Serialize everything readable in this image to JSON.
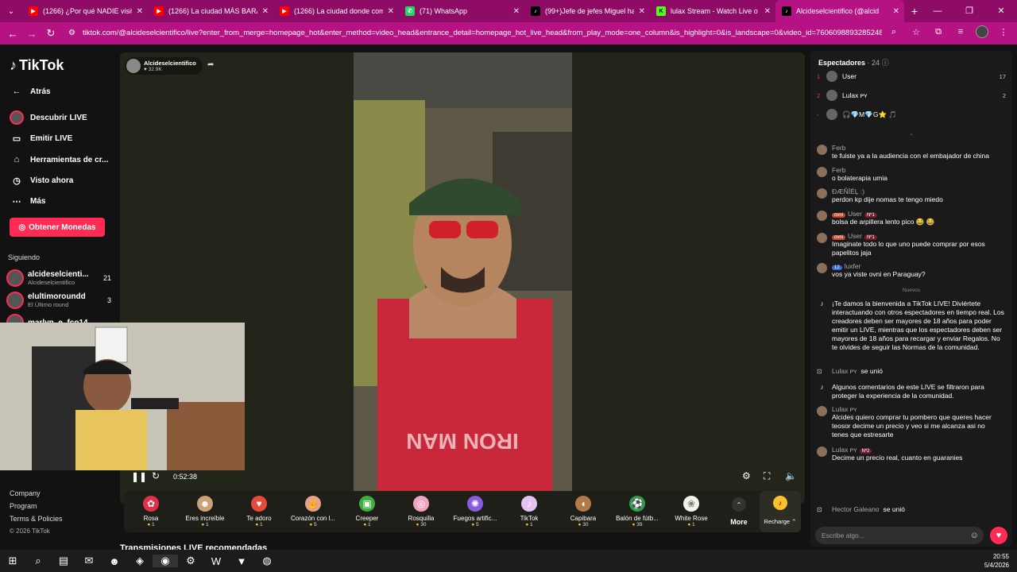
{
  "browser": {
    "tabs": [
      {
        "title": "(1266) ¿Por qué NADIE visita Pa",
        "icon": "youtube-icon",
        "color": "#ff0000"
      },
      {
        "title": "(1266) La ciudad MÁS BARATA",
        "icon": "youtube-icon",
        "color": "#ff0000"
      },
      {
        "title": "(1266) La ciudad donde compr",
        "icon": "youtube-icon",
        "color": "#ff0000"
      },
      {
        "title": "(71) WhatsApp",
        "icon": "whatsapp-icon",
        "color": "#25d366"
      },
      {
        "title": "(99+)Jefe de jefes Miguel haed",
        "icon": "tiktok-icon",
        "color": "#000000"
      },
      {
        "title": "lulax Stream - Watch Live o",
        "icon": "kick-icon",
        "color": "#53fc18"
      },
      {
        "title": "Alcideselcientifico (@alcid",
        "icon": "tiktok-icon",
        "color": "#000000",
        "active": true
      }
    ],
    "url": "tiktok.com/@alcideselcientifico/live?enter_from_merge=homepage_hot&enter_method=video_head&entrance_detail=homepage_hot_live_head&from_play_mode=one_column&is_highlight=0&is_landscape=0&video_id=7606098893285248277"
  },
  "sidebar": {
    "logo": "TikTok",
    "nav": [
      {
        "label": "Atrás",
        "icon": "back-arrow-icon"
      },
      {
        "label": "Descubrir LIVE",
        "icon": "live-avatar-icon"
      },
      {
        "label": "Emitir LIVE",
        "icon": "camera-icon"
      },
      {
        "label": "Herramientas de cr...",
        "icon": "lightbulb-icon"
      },
      {
        "label": "Visto ahora",
        "icon": "history-icon"
      },
      {
        "label": "Más",
        "icon": "more-dots-icon"
      }
    ],
    "coins_button": "Obtener Monedas",
    "following_label": "Siguiendo",
    "following": [
      {
        "name": "alcideselcienti...",
        "sub": "Alcideselcientifico",
        "count": "21"
      },
      {
        "name": "elultimoroundd",
        "sub": "El Último round",
        "count": "3"
      },
      {
        "name": "marlyn_e_fco14",
        "sub": "",
        "count": ""
      }
    ],
    "footer": {
      "company": "Company",
      "program": "Program",
      "terms": "Terms & Policies",
      "copyright": "© 2026 TikTok"
    }
  },
  "player": {
    "host_name": "Alcideselcientifico",
    "host_likes": "32.9K",
    "time": "0:52:38"
  },
  "gifts": [
    {
      "name": "Rosa",
      "price": "1",
      "icon": "rose-icon",
      "color": "#e0304a"
    },
    {
      "name": "Eres increíble",
      "price": "1",
      "icon": "cat-icon",
      "color": "#c9a27a"
    },
    {
      "name": "Te adoro",
      "price": "1",
      "icon": "heart-ball-icon",
      "color": "#e84a3a"
    },
    {
      "name": "Corazón con l...",
      "price": "5",
      "icon": "finger-heart-icon",
      "color": "#e7a08a"
    },
    {
      "name": "Creeper",
      "price": "1",
      "icon": "creeper-icon",
      "color": "#3fae3f"
    },
    {
      "name": "Rosquilla",
      "price": "30",
      "icon": "donut-icon",
      "color": "#f2a3c0"
    },
    {
      "name": "Fuegos artific...",
      "price": "5",
      "icon": "fireworks-icon",
      "color": "#8a5be0"
    },
    {
      "name": "TikTok",
      "price": "1",
      "icon": "tiktok-gift-icon",
      "color": "#e5c2f0"
    },
    {
      "name": "Capibara",
      "price": "30",
      "icon": "capybara-icon",
      "color": "#b07a4a"
    },
    {
      "name": "Balón de fútb...",
      "price": "39",
      "icon": "soccer-ball-icon",
      "color": "#2f9e4a"
    },
    {
      "name": "White Rose",
      "price": "1",
      "icon": "white-rose-icon",
      "color": "#f2f2e8"
    }
  ],
  "more_label": "More",
  "recharge_label": "Recharge",
  "recommended_title": "Transmisiones LIVE recomendadas",
  "chat": {
    "viewers_label": "Espectadores",
    "viewers_count": "· 24",
    "top_viewers": [
      {
        "rank": "1",
        "name": "User",
        "score": "17"
      },
      {
        "rank": "2",
        "name": "Lulax ᴘʏ",
        "score": "2"
      },
      {
        "rank": "-",
        "name": "🎧💎M💎G⭐ 🎵",
        "score": ""
      }
    ],
    "messages": [
      {
        "user": "Ferb",
        "text": "te fuiste ya a la audiencia con el embajador de china"
      },
      {
        "user": "Ferb",
        "text": "o bolaterapia umia"
      },
      {
        "user": "ÐÆÑĪÉĻ :)",
        "text": "perdon kp dije nomas te tengo miedo"
      },
      {
        "user": "User",
        "badge": "ovni",
        "rank_badge": "Nº1",
        "text": "bolsa de arpillera lento pico 😂 😂"
      },
      {
        "user": "User",
        "badge": "ovni",
        "rank_badge": "Nº1",
        "text": "Imaginate todo lo que uno puede comprar por esos papelitos jaja"
      },
      {
        "user": "luxfer",
        "level": "12",
        "text": "vos ya viste ovni en Paraguay?"
      }
    ],
    "new_label": "Nuevos",
    "welcome": "¡Te damos la bienvenida a TikTok LIVE! Diviértete interactuando con otros espectadores en tiempo real. Los creadores deben ser mayores de 18 años para poder emitir un LIVE, mientras que los espectadores deben ser mayores de 18 años para recargar y enviar Regalos. No te olvides de seguir las Normas de la comunidad.",
    "join1": {
      "name": "Lulax ᴘʏ",
      "action": "se unió"
    },
    "filter_notice": "Algunos comentarios de este LIVE se filtraron para proteger la experiencia de la comunidad.",
    "messages2": [
      {
        "user": "Lulax ᴘʏ",
        "text": "Alcides quiero comprar tu pombero que queres hacer teosor decime un precio y veo si me alcanza asi no tenes que estresarte"
      },
      {
        "user": "Lulax ᴘʏ",
        "rank_badge": "Nº2",
        "text": "Decime un precio real, cuanto en guaranies"
      }
    ],
    "join2": {
      "name": "Hector Galeano",
      "action": "se unió"
    },
    "input_placeholder": "Escribe algo..."
  },
  "taskbar": {
    "time": "20:55",
    "date": "5/4/2026"
  }
}
